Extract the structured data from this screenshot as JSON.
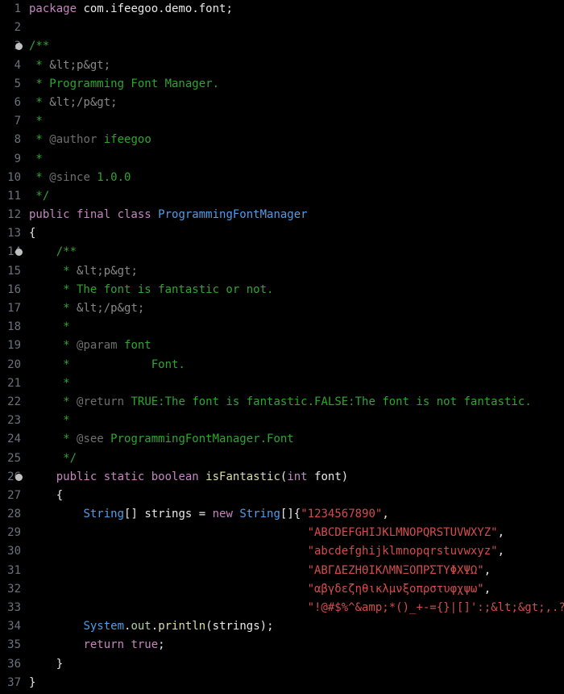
{
  "gutter": {
    "start": 1,
    "end": 37,
    "fold_lines": [
      3,
      14,
      26
    ]
  },
  "code": {
    "l1": {
      "kw": "package",
      "sp": " ",
      "pkg": "com.ifeegoo.demo.font",
      "semi": ";"
    },
    "l3": "/**",
    "l4": {
      "pre": " * ",
      "open": "<p>"
    },
    "l5": " * Programming Font Manager.",
    "l6": {
      "pre": " * ",
      "close": "</p>"
    },
    "l7": " *",
    "l8": {
      "pre": " * ",
      "tag": "@author",
      "val": " ifeegoo"
    },
    "l9": " *",
    "l10": {
      "pre": " * ",
      "tag": "@since",
      "val": " 1.0.0"
    },
    "l11": " */",
    "l12": {
      "mods": "public final class ",
      "name": "ProgrammingFontManager"
    },
    "l13": "{",
    "l14": "    /**",
    "l15": {
      "pre": "     * ",
      "open": "<p>"
    },
    "l16": "     * The font is fantastic or not.",
    "l17": {
      "pre": "     * ",
      "close": "</p>"
    },
    "l18": "     *",
    "l19": {
      "pre": "     * ",
      "tag": "@param",
      "val": " font"
    },
    "l20": "     *            Font.",
    "l21": "     *",
    "l22": {
      "pre": "     * ",
      "tag": "@return",
      "val": " TRUE:The font is fantastic.FALSE:The font is not fantastic."
    },
    "l23": "     *",
    "l24": {
      "pre": "     * ",
      "tag": "@see",
      "val": " ProgrammingFontManager.Font"
    },
    "l25": "     */",
    "l26": {
      "indent": "    ",
      "mods": "public static ",
      "ret": "boolean ",
      "name": "isFantastic",
      "paren_o": "(",
      "ptype": "int ",
      "pname": "font",
      "paren_c": ")"
    },
    "l27": "    {",
    "l28": {
      "indent": "        ",
      "type": "String",
      "br": "[] ",
      "var": "strings",
      " eq ": " = ",
      "new": "new ",
      "type2": "String",
      "br2": "[]{",
      "str": "\"1234567890\"",
      "comma": ","
    },
    "l29": {
      "indent": "                                         ",
      "str": "\"ABCDEFGHIJKLMNOPQRSTUVWXYZ\"",
      "comma": ","
    },
    "l30": {
      "indent": "                                         ",
      "str": "\"abcdefghijklmnopqrstuvwxyz\"",
      "comma": ","
    },
    "l31": {
      "indent": "                                         ",
      "str": "\"ΑΒΓΔΕΖΗΘΙΚΛΜΝΞΟΠΡΣΤΥΦΧΨΩ\"",
      "comma": ","
    },
    "l32": {
      "indent": "                                         ",
      "str": "\"αβγδεζηθικλμνξοπρστυφχψω\"",
      "comma": ","
    },
    "l33": {
      "indent": "                                         ",
      "str": "\"!@#$%^&*()_+-={}|[]':;<>,.?\"",
      "end": "};"
    },
    "l34": {
      "indent": "        ",
      "obj": "System",
      "dot1": ".",
      "field": "out",
      "dot2": ".",
      "call": "println",
      "paren_o": "(",
      "arg": "strings",
      "paren_c": ");"
    },
    "l35": {
      "indent": "        ",
      "kw": "return ",
      "val": "true",
      "semi": ";"
    },
    "l36": "    }",
    "l37": "}"
  }
}
